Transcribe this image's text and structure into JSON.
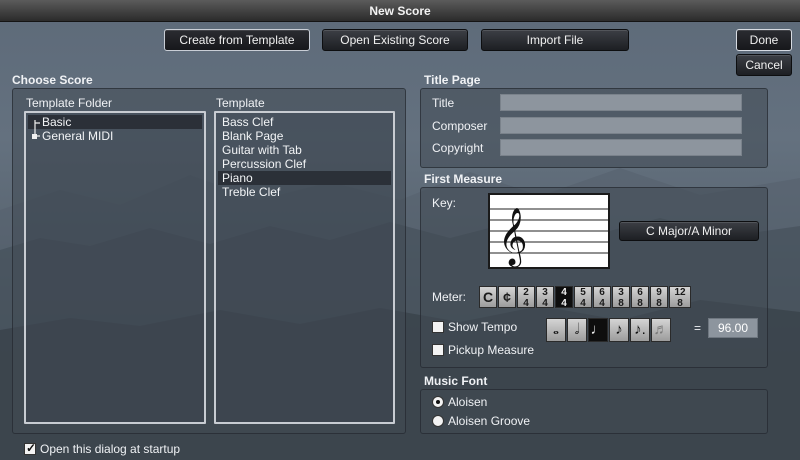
{
  "window": {
    "title": "New Score"
  },
  "toolbar": {
    "create_from_template": "Create from Template",
    "open_existing_score": "Open Existing Score",
    "import_file": "Import File",
    "done": "Done",
    "cancel": "Cancel"
  },
  "choose_score": {
    "label": "Choose Score",
    "template_folder_header": "Template Folder",
    "folders": [
      "Basic",
      "General MIDI"
    ],
    "selected_folder": "Basic",
    "template_header": "Template",
    "templates": [
      "Bass Clef",
      "Blank Page",
      "Guitar with Tab",
      "Percussion Clef",
      "Piano",
      "Treble Clef"
    ],
    "selected_template": "Piano"
  },
  "title_page": {
    "label": "Title Page",
    "title_label": "Title",
    "title_value": "",
    "composer_label": "Composer",
    "composer_value": "",
    "copyright_label": "Copyright",
    "copyright_value": ""
  },
  "first_measure": {
    "label": "First Measure",
    "key_label": "Key:",
    "key_value": "C Major/A Minor",
    "meter_label": "Meter:",
    "meters": [
      {
        "top": "C",
        "bottom": ""
      },
      {
        "top": "¢",
        "bottom": ""
      },
      {
        "top": "2",
        "bottom": "4"
      },
      {
        "top": "3",
        "bottom": "4"
      },
      {
        "top": "4",
        "bottom": "4"
      },
      {
        "top": "5",
        "bottom": "4"
      },
      {
        "top": "6",
        "bottom": "4"
      },
      {
        "top": "3",
        "bottom": "8"
      },
      {
        "top": "6",
        "bottom": "8"
      },
      {
        "top": "9",
        "bottom": "8"
      },
      {
        "top": "12",
        "bottom": "8"
      }
    ],
    "selected_meter": "4/4",
    "show_tempo_label": "Show Tempo",
    "show_tempo_checked": false,
    "tempo_notes": [
      "whole-note-icon",
      "half-note-icon",
      "quarter-note-icon",
      "eighth-note-icon",
      "dotted-eighth-note-icon",
      "sixteenth-note-icon"
    ],
    "selected_tempo_note": "quarter-note-icon",
    "tempo_equals": "=",
    "tempo_value": "96.00",
    "pickup_measure_label": "Pickup Measure",
    "pickup_measure_checked": false
  },
  "music_font": {
    "label": "Music Font",
    "options": [
      "Aloisen",
      "Aloisen Groove"
    ],
    "selected": "Aloisen"
  },
  "footer": {
    "open_at_startup_label": "Open this dialog at startup",
    "open_at_startup_checked": true
  }
}
